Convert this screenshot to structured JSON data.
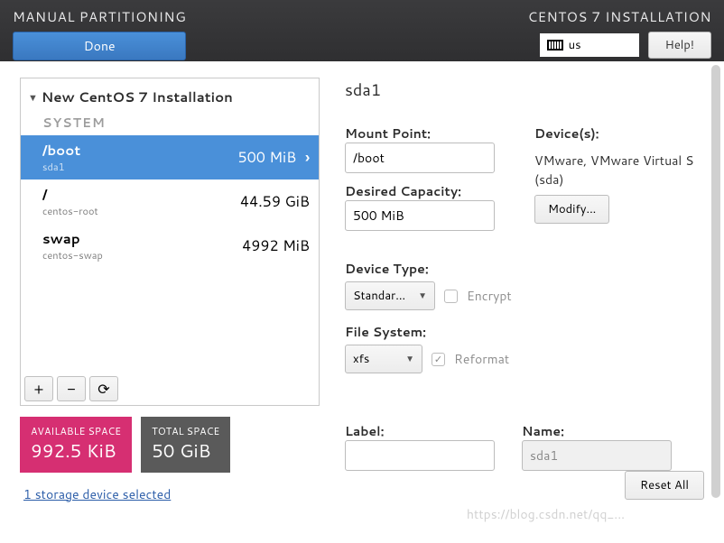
{
  "header": {
    "title_left": "MANUAL PARTITIONING",
    "done_label": "Done",
    "title_right": "CENTOS 7 INSTALLATION",
    "keyboard_layout": "us",
    "help_label": "Help!"
  },
  "tree": {
    "header": "New CentOS 7 Installation",
    "system_label": "SYSTEM",
    "partitions": [
      {
        "mount": "/boot",
        "device": "sda1",
        "size": "500 MiB",
        "selected": true
      },
      {
        "mount": "/",
        "device": "centos-root",
        "size": "44.59 GiB",
        "selected": false
      },
      {
        "mount": "swap",
        "device": "centos-swap",
        "size": "4992 MiB",
        "selected": false
      }
    ]
  },
  "toolbar": {
    "add": "+",
    "remove": "−",
    "reload": "⟳"
  },
  "stats": {
    "available_label": "AVAILABLE SPACE",
    "available_value": "992.5 KiB",
    "total_label": "TOTAL SPACE",
    "total_value": "50 GiB"
  },
  "storage_link": "1 storage device selected",
  "details": {
    "title": "sda1",
    "mount_point_label": "Mount Point:",
    "mount_point_value": "/boot",
    "desired_capacity_label": "Desired Capacity:",
    "desired_capacity_value": "500 MiB",
    "devices_label": "Device(s):",
    "devices_text": "VMware, VMware Virtual S (sda)",
    "modify_label": "Modify...",
    "device_type_label": "Device Type:",
    "device_type_value": "Standar...",
    "encrypt_label": "Encrypt",
    "encrypt_checked": false,
    "file_system_label": "File System:",
    "file_system_value": "xfs",
    "reformat_label": "Reformat",
    "reformat_checked": true,
    "label_label": "Label:",
    "label_value": "",
    "name_label": "Name:",
    "name_value": "sda1"
  },
  "reset_label": "Reset All",
  "watermark": "https://blog.csdn.net/qq_..."
}
